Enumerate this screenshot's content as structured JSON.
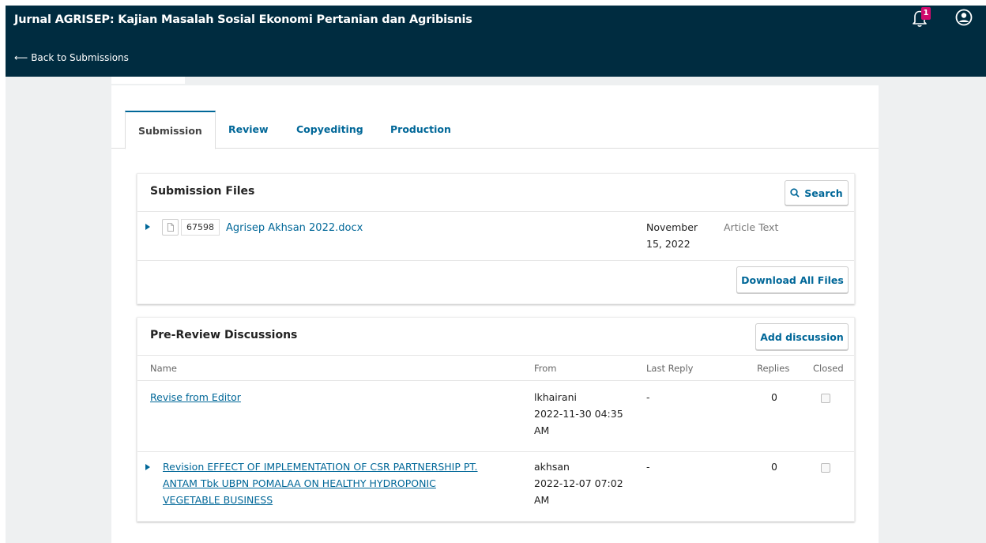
{
  "header": {
    "site_title": "Jurnal AGRISEP: Kajian Masalah Sosial Ekonomi Pertanian dan Agribisnis",
    "back_label": "Back to Submissions",
    "notification_count": "1",
    "icons": {
      "bell": "bell-icon",
      "user": "user-circle-icon",
      "back": "arrow-left-icon"
    }
  },
  "tabs": [
    {
      "label": "Submission",
      "active": true
    },
    {
      "label": "Review",
      "active": false
    },
    {
      "label": "Copyediting",
      "active": false
    },
    {
      "label": "Production",
      "active": false
    }
  ],
  "submission_files": {
    "title": "Submission Files",
    "search_label": "Search",
    "download_all_label": "Download All Files",
    "files": [
      {
        "id": "67598",
        "name": "Agrisep Akhsan 2022.docx",
        "date_line1": "November",
        "date_line2": "15, 2022",
        "type": "Article Text"
      }
    ]
  },
  "discussions": {
    "title": "Pre-Review Discussions",
    "add_label": "Add discussion",
    "columns": {
      "name": "Name",
      "from": "From",
      "last_reply": "Last Reply",
      "replies": "Replies",
      "closed": "Closed"
    },
    "rows": [
      {
        "name_lines": [
          "Revise from Editor"
        ],
        "from_user": "lkhairani",
        "from_date1": "2022-11-30 04:35",
        "from_date2": "AM",
        "last_reply": "-",
        "replies": "0",
        "closed": false,
        "expandable": false
      },
      {
        "name_lines": [
          "Revision EFFECT OF IMPLEMENTATION OF CSR PARTNERSHIP PT.",
          "ANTAM Tbk UBPN POMALAA ON HEALTHY HYDROPONIC",
          "VEGETABLE BUSINESS"
        ],
        "from_user": "akhsan",
        "from_date1": "2022-12-07 07:02",
        "from_date2": "AM",
        "last_reply": "-",
        "replies": "0",
        "closed": false,
        "expandable": true
      }
    ]
  },
  "colors": {
    "header_bg": "#002c40",
    "link": "#006798",
    "badge": "#d00a6c",
    "page_bg": "#eef0f1"
  }
}
